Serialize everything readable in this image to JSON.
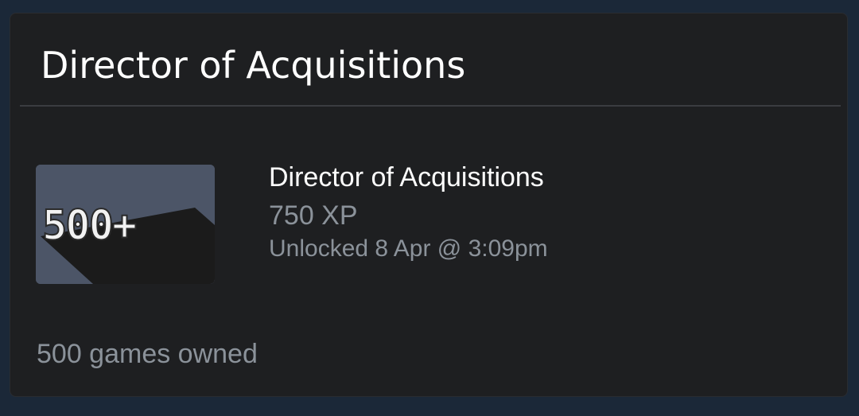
{
  "card": {
    "title": "Director of Acquisitions"
  },
  "achievement": {
    "icon_text": "500+",
    "name": "Director of Acquisitions",
    "xp": "750 XP",
    "unlocked": "Unlocked 8 Apr @ 3:09pm",
    "description": "500 games owned"
  },
  "colors": {
    "page_background": "#1b2838",
    "card_background": "#1e1f21",
    "badge_background": "#4c5567",
    "badge_shadow": "#1a1a1a",
    "primary_text": "#ffffff",
    "secondary_text": "#8b929a"
  }
}
